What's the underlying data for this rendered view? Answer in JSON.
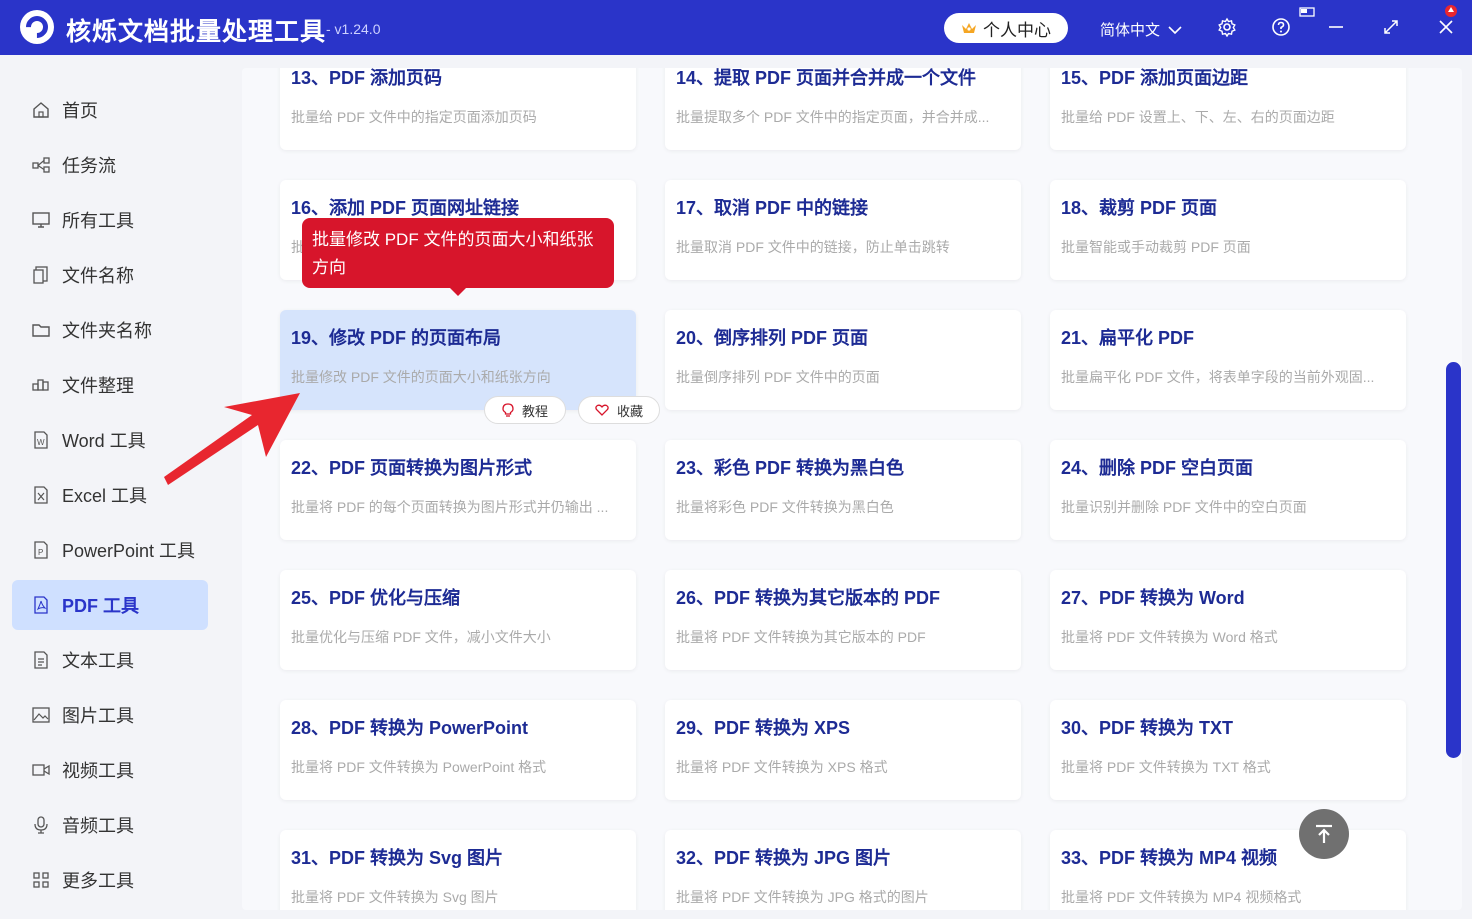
{
  "app": {
    "title": "核烁文档批量处理工具",
    "version": "- v1.24.0",
    "user_center": "个人中心",
    "language": "简体中文",
    "icons": [
      "settings-icon",
      "help-icon",
      "minimize-icon",
      "maximize-icon",
      "close-icon"
    ]
  },
  "sidebar": {
    "items": [
      {
        "label": "首页",
        "icon": "home-icon"
      },
      {
        "label": "任务流",
        "icon": "workflow-icon"
      },
      {
        "label": "所有工具",
        "icon": "monitor-icon"
      },
      {
        "label": "文件名称",
        "icon": "file-name-icon"
      },
      {
        "label": "文件夹名称",
        "icon": "folder-icon"
      },
      {
        "label": "文件整理",
        "icon": "organize-icon"
      },
      {
        "label": "Word 工具",
        "icon": "word-icon"
      },
      {
        "label": "Excel 工具",
        "icon": "excel-icon"
      },
      {
        "label": "PowerPoint 工具",
        "icon": "ppt-icon"
      },
      {
        "label": "PDF 工具",
        "icon": "pdf-icon",
        "active": true
      },
      {
        "label": "文本工具",
        "icon": "text-icon"
      },
      {
        "label": "图片工具",
        "icon": "image-icon"
      },
      {
        "label": "视频工具",
        "icon": "video-icon"
      },
      {
        "label": "音频工具",
        "icon": "audio-icon"
      },
      {
        "label": "更多工具",
        "icon": "grid-icon"
      }
    ],
    "active_color": "#2a34c9"
  },
  "tools": [
    {
      "title": "13、PDF 添加页码",
      "desc": "批量给 PDF 文件中的指定页面添加页码"
    },
    {
      "title": "14、提取 PDF 页面并合并成一个文件",
      "desc": "批量提取多个 PDF 文件中的指定页面，并合并成..."
    },
    {
      "title": "15、PDF 添加页面边距",
      "desc": "批量给 PDF 设置上、下、左、右的页面边距"
    },
    {
      "title": "16、添加 PDF 页面网址链接",
      "desc": "批..."
    },
    {
      "title": "17、取消 PDF 中的链接",
      "desc": "批量取消 PDF 文件中的链接，防止单击跳转"
    },
    {
      "title": "18、裁剪 PDF 页面",
      "desc": "批量智能或手动裁剪 PDF 页面"
    },
    {
      "title": "19、修改 PDF 的页面布局",
      "desc": "批量修改 PDF 文件的页面大小和纸张方向",
      "highlighted": true
    },
    {
      "title": "20、倒序排列 PDF 页面",
      "desc": "批量倒序排列 PDF 文件中的页面"
    },
    {
      "title": "21、扁平化 PDF",
      "desc": "批量扁平化 PDF 文件，将表单字段的当前外观固..."
    },
    {
      "title": "22、PDF 页面转换为图片形式",
      "desc": "批量将 PDF 的每个页面转换为图片形式并仍输出 ..."
    },
    {
      "title": "23、彩色 PDF 转换为黑白色",
      "desc": "批量将彩色 PDF 文件转换为黑白色"
    },
    {
      "title": "24、删除 PDF 空白页面",
      "desc": "批量识别并删除 PDF 文件中的空白页面"
    },
    {
      "title": "25、PDF 优化与压缩",
      "desc": "批量优化与压缩 PDF 文件，减小文件大小"
    },
    {
      "title": "26、PDF 转换为其它版本的 PDF",
      "desc": "批量将 PDF 文件转换为其它版本的 PDF"
    },
    {
      "title": "27、PDF 转换为 Word",
      "desc": "批量将 PDF 文件转换为 Word 格式"
    },
    {
      "title": "28、PDF 转换为 PowerPoint",
      "desc": "批量将 PDF 文件转换为 PowerPoint 格式"
    },
    {
      "title": "29、PDF 转换为 XPS",
      "desc": "批量将 PDF 文件转换为 XPS 格式"
    },
    {
      "title": "30、PDF 转换为 TXT",
      "desc": "批量将 PDF 文件转换为 TXT 格式"
    },
    {
      "title": "31、PDF 转换为 Svg 图片",
      "desc": "批量将 PDF 文件转换为 Svg 图片"
    },
    {
      "title": "32、PDF 转换为 JPG 图片",
      "desc": "批量将 PDF 文件转换为 JPG 格式的图片"
    },
    {
      "title": "33、PDF 转换为 MP4 视频",
      "desc": "批量将 PDF 文件转换为 MP4 视频格式"
    }
  ],
  "tooltip": {
    "text": "批量修改 PDF 文件的页面大小和纸张方向"
  },
  "card_actions": {
    "tutorial": "教程",
    "favorite": "收藏"
  },
  "colors": {
    "title_bar": "#2a34c9",
    "card_title": "#1d2b94",
    "highlight": "#d6e4fc",
    "tooltip": "#d7152b",
    "arrow": "#e8262f"
  }
}
